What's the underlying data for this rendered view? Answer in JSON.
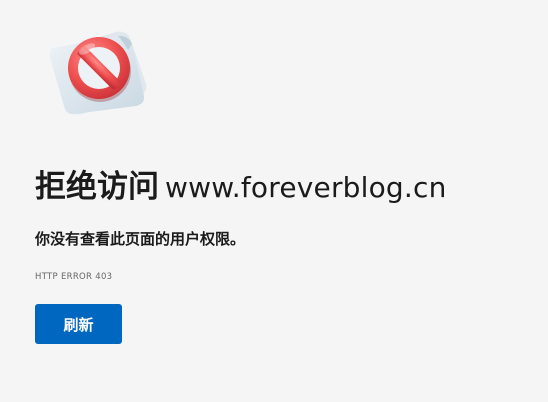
{
  "page": {
    "title_prefix": "拒绝访问",
    "hostname": "www.foreverblog.cn",
    "message": "你没有查看此页面的用户权限。",
    "error_code": "HTTP ERROR 403",
    "refresh_label": "刷新"
  },
  "icons": {
    "illustration": "blocked-document-icon"
  },
  "colors": {
    "background": "#f5f5f5",
    "text": "#1b1b1b",
    "secondary_text": "#666666",
    "button": "#0067c0",
    "prohibited_red": "#e84a4a"
  }
}
